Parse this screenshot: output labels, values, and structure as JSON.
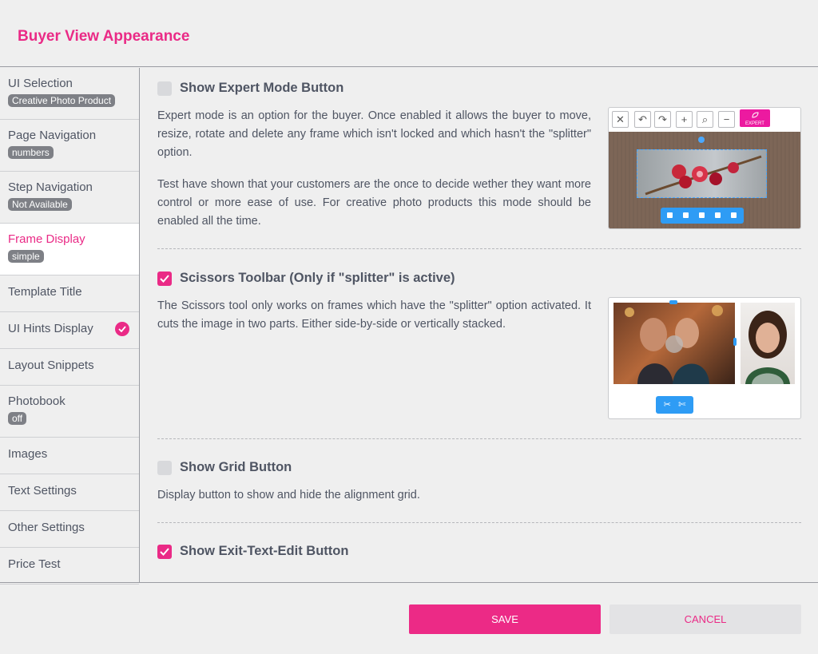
{
  "page_title": "Buyer View Appearance",
  "sidebar": {
    "items": [
      {
        "label": "UI Selection",
        "badge": "Creative Photo Product"
      },
      {
        "label": "Page Navigation",
        "badge": "numbers"
      },
      {
        "label": "Step Navigation",
        "badge": "Not Available"
      },
      {
        "label": "Frame Display",
        "badge": "simple",
        "active": true
      },
      {
        "label": "Template Title"
      },
      {
        "label": "UI Hints Display",
        "icon": "check-circle-icon"
      },
      {
        "label": "Layout Snippets"
      },
      {
        "label": "Photobook",
        "badge": "off"
      },
      {
        "label": "Images"
      },
      {
        "label": "Text Settings"
      },
      {
        "label": "Other Settings"
      },
      {
        "label": "Price Test"
      }
    ]
  },
  "sections": {
    "expert": {
      "title": "Show Expert Mode Button",
      "checked": false,
      "p1": "Expert mode is an option for the buyer. Once enabled it allows the buyer to move, resize, rotate and delete any frame which isn't locked and which hasn't the \"splitter\" option.",
      "p2": "Test have shown that your customers are the once to decide wether they want more control or more ease of use. For creative photo products this mode should be enabled all the time.",
      "expert_label": "EXPERT"
    },
    "scissors": {
      "title": "Scissors Toolbar (Only if \"splitter\" is active)",
      "checked": true,
      "p1": "The Scissors tool only works on frames which have the \"splitter\" option activated. It cuts the image in two parts. Either side-by-side or vertically stacked."
    },
    "grid": {
      "title": "Show Grid Button",
      "checked": false,
      "p1": "Display button to show and hide the alignment grid."
    },
    "exit_text": {
      "title": "Show Exit-Text-Edit Button",
      "checked": true
    }
  },
  "footer": {
    "save_label": "SAVE",
    "cancel_label": "CANCEL"
  },
  "colors": {
    "accent": "#ea2a86",
    "badge": "#7e8086",
    "toolbar_blue": "#2e9cf5"
  }
}
